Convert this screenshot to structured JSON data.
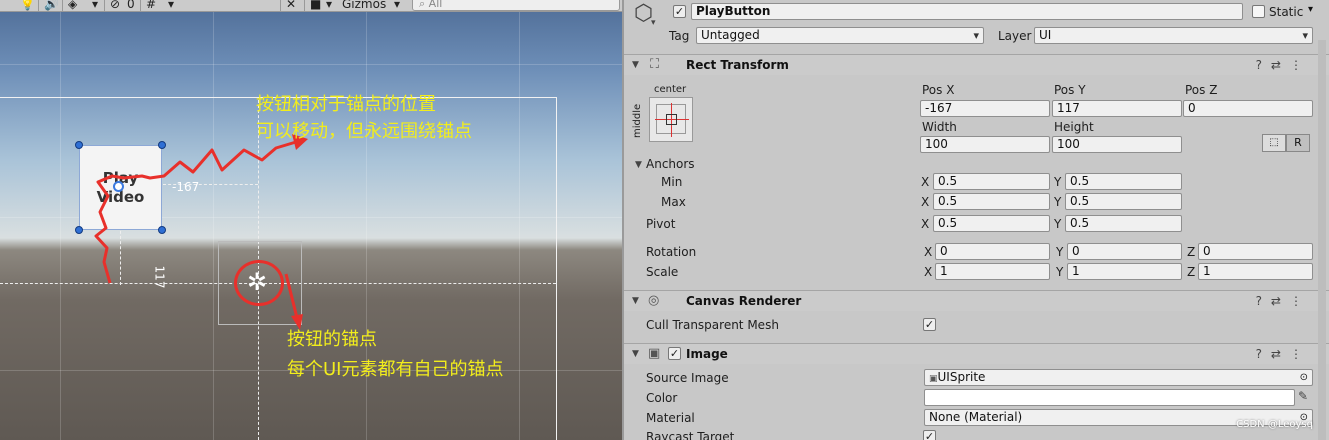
{
  "scene": {
    "toolbar": {
      "hidden_count": "0",
      "gizmos_label": "Gizmos",
      "search_placeholder": "All"
    },
    "play_button_text": "Play\nVideo",
    "distance_x": "-167",
    "distance_y": "117",
    "annotations": {
      "line1": "按钮相对于锚点的位置",
      "line2": "可以移动，但永远围绕锚点",
      "line3": "按钮的锚点",
      "line4": "每个UI元素都有自己的锚点"
    },
    "icons": [
      "light-icon",
      "audio-icon",
      "effects-icon",
      "visibility-icon",
      "grid-icon",
      "tools-icon",
      "camera-icon",
      "search-icon"
    ]
  },
  "inspector": {
    "object_name": "PlayButton",
    "static_label": "Static",
    "tag_label": "Tag",
    "tag_value": "Untagged",
    "layer_label": "Layer",
    "layer_value": "UI",
    "rect_transform": {
      "title": "Rect Transform",
      "anchor_preset_top": "center",
      "anchor_preset_side": "middle",
      "pos_x_label": "Pos X",
      "pos_y_label": "Pos Y",
      "pos_z_label": "Pos Z",
      "pos_x": "-167",
      "pos_y": "117",
      "pos_z": "0",
      "width_label": "Width",
      "height_label": "Height",
      "width": "100",
      "height": "100",
      "raw_button": "R",
      "anchors_label": "Anchors",
      "min_label": "Min",
      "max_label": "Max",
      "pivot_label": "Pivot",
      "x": "X",
      "y": "Y",
      "z": "Z",
      "anchor_min_x": "0.5",
      "anchor_min_y": "0.5",
      "anchor_max_x": "0.5",
      "anchor_max_y": "0.5",
      "pivot_x": "0.5",
      "pivot_y": "0.5",
      "rotation_label": "Rotation",
      "rotation_x": "0",
      "rotation_y": "0",
      "rotation_z": "0",
      "scale_label": "Scale",
      "scale_x": "1",
      "scale_y": "1",
      "scale_z": "1"
    },
    "canvas_renderer": {
      "title": "Canvas Renderer",
      "cull_label": "Cull Transparent Mesh"
    },
    "image": {
      "title": "Image",
      "source_image_label": "Source Image",
      "source_image_value": "UISprite",
      "color_label": "Color",
      "material_label": "Material",
      "material_value": "None (Material)",
      "raycast_label": "Raycast Target"
    },
    "watermark": "CSDN @Leoysq"
  }
}
